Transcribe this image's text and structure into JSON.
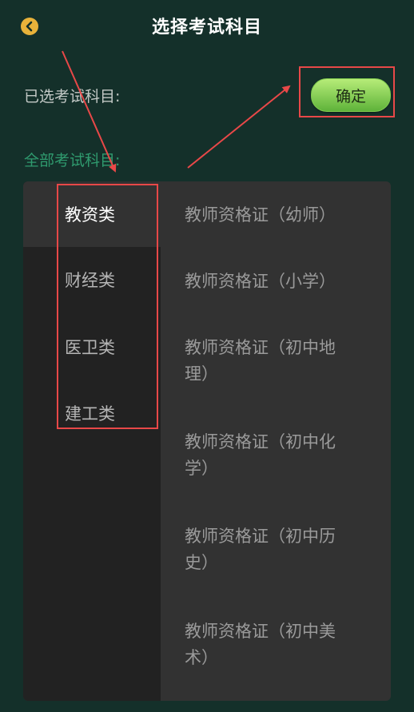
{
  "header": {
    "title": "选择考试科目",
    "back_icon": "chevron-left-icon"
  },
  "selected": {
    "label": "已选考试科目:",
    "confirm_label": "确定"
  },
  "all_label": "全部考试科目:",
  "categories": [
    {
      "label": "教资类",
      "active": true
    },
    {
      "label": "财经类",
      "active": false
    },
    {
      "label": "医卫类",
      "active": false
    },
    {
      "label": "建工类",
      "active": false
    }
  ],
  "subjects": [
    {
      "label": "教师资格证（幼师）"
    },
    {
      "label": "教师资格证（小学）"
    },
    {
      "label": "教师资格证（初中地理）"
    },
    {
      "label": "教师资格证（初中化学）"
    },
    {
      "label": "教师资格证（初中历史）"
    },
    {
      "label": "教师资格证（初中美术）"
    }
  ],
  "colors": {
    "background": "#14302a",
    "accent_green": "#2f9a6e",
    "button_green": "#7fca4f",
    "annotation_red": "#e84848",
    "back_icon": "#e8b23a"
  }
}
